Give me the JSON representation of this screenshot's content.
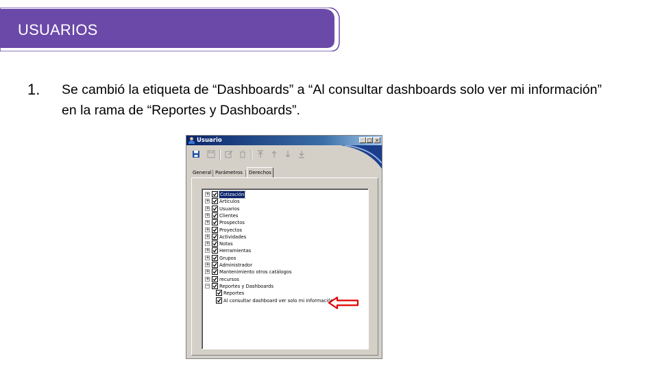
{
  "banner": {
    "title": "USUARIOS",
    "color": "#6b49a8"
  },
  "step": {
    "number": "1.",
    "text": "Se cambió la etiqueta de “Dashboards” a “Al consultar dashboards solo ver mi información” en la rama de “Reportes y Dashboards”."
  },
  "window": {
    "title": "Usuario",
    "title_icon": "user-icon",
    "controls": {
      "minimize": "_",
      "maximize": "□",
      "close": "×"
    },
    "toolbar_icons": [
      "save-icon",
      "save-disabled-icon",
      "edit-icon",
      "delete-icon",
      "move-top-icon",
      "move-up-icon",
      "move-down-icon",
      "move-bottom-icon"
    ],
    "tabs": [
      {
        "label": "General",
        "active": false
      },
      {
        "label": "Parámetros",
        "active": false
      },
      {
        "label": "Derechos",
        "active": true
      }
    ],
    "tree": [
      {
        "label": "Cotización",
        "expander": "+",
        "checked": true,
        "selected": true
      },
      {
        "label": "Artículos",
        "expander": "+",
        "checked": true
      },
      {
        "label": "Usuarios",
        "expander": "+",
        "checked": true
      },
      {
        "label": "Clientes",
        "expander": "+",
        "checked": true
      },
      {
        "label": "Prospectos",
        "expander": "+",
        "checked": true
      },
      {
        "label": "Proyectos",
        "expander": "+",
        "checked": true
      },
      {
        "label": "Actividades",
        "expander": "+",
        "checked": true
      },
      {
        "label": "Notas",
        "expander": "+",
        "checked": true
      },
      {
        "label": "Herramientas",
        "expander": "+",
        "checked": true
      },
      {
        "label": "Grupos",
        "expander": "+",
        "checked": true
      },
      {
        "label": "Administrador",
        "expander": "+",
        "checked": true
      },
      {
        "label": "Mantenimiento otros catálogos",
        "expander": "+",
        "checked": true
      },
      {
        "label": "recursos",
        "expander": "+",
        "checked": true
      },
      {
        "label": "Reportes y Dashboards",
        "expander": "−",
        "checked": true,
        "children": [
          {
            "label": "Reportes",
            "checked": true
          },
          {
            "label": "Al consultar dashboard ver solo mi información",
            "checked": true
          }
        ]
      }
    ]
  },
  "annotation": {
    "arrow_color": "#e00000",
    "arrow_icon": "left-arrow-icon"
  }
}
